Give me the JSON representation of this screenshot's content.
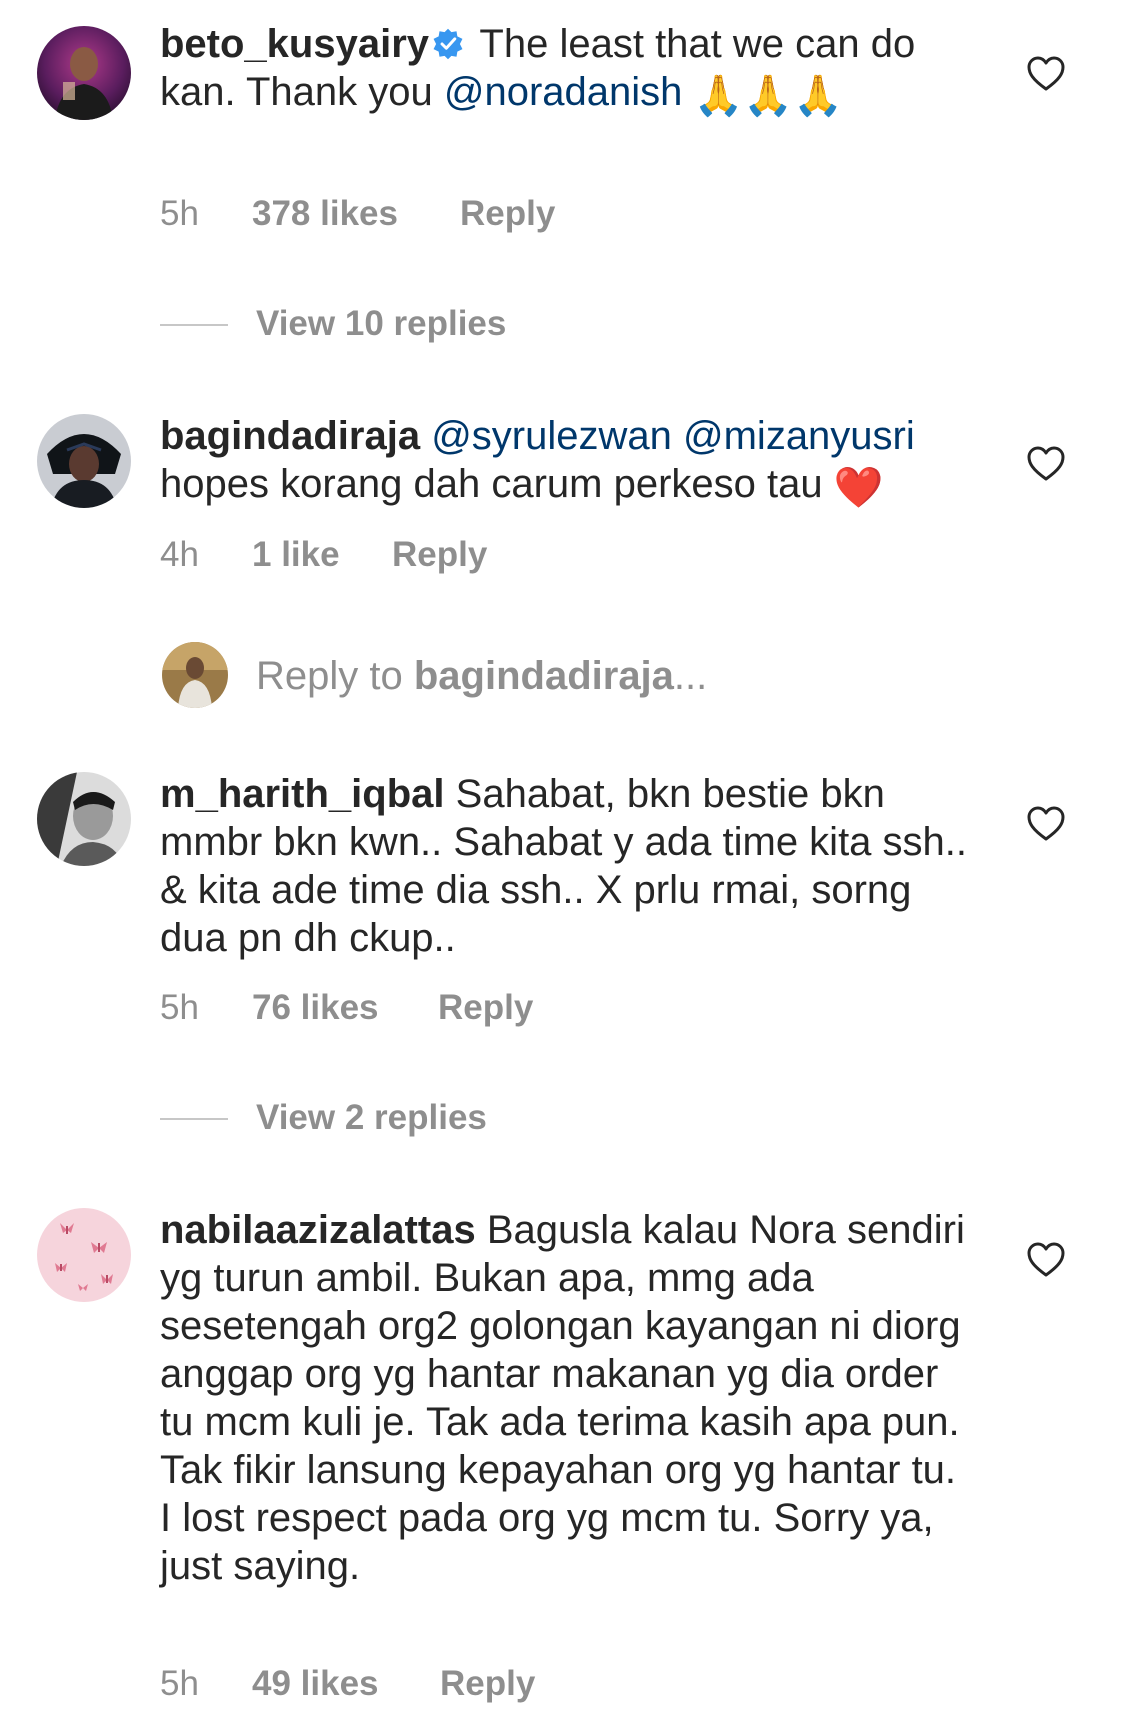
{
  "comments": [
    {
      "username": "beto_kusyairy",
      "verified": true,
      "text_before": "The least that we can do kan. Thank you ",
      "mention": "@noradanish",
      "emoji": "🙏🙏🙏",
      "time": "5h",
      "likes": "378 likes",
      "reply_label": "Reply",
      "view_replies": "View 10 replies"
    },
    {
      "username": "bagindadiraja",
      "mention1": "@syrulezwan",
      "mention2": "@mizanyusri",
      "text": "hopes korang dah carum perkeso tau",
      "emoji": "❤️",
      "time": "4h",
      "likes": "1 like",
      "reply_label": "Reply",
      "reply_prompt_prefix": "Reply to ",
      "reply_prompt_user": "bagindadiraja",
      "reply_prompt_suffix": "..."
    },
    {
      "username": "m_harith_iqbal",
      "text": "Sahabat, bkn bestie bkn mmbr bkn kwn.. Sahabat y ada time kita ssh.. & kita ade time dia ssh.. X prlu rmai, sorng dua pn dh ckup..",
      "time": "5h",
      "likes": "76 likes",
      "reply_label": "Reply",
      "view_replies": "View 2 replies"
    },
    {
      "username": "nabilaazizalattas",
      "text": "Bagusla kalau Nora sendiri yg turun ambil. Bukan apa, mmg ada sesetengah org2 golongan kayangan ni diorg anggap org yg hantar makanan yg dia order tu mcm kuli je. Tak ada terima kasih apa pun. Tak fikir lansung kepayahan org yg hantar tu. I lost respect pada org yg mcm tu. Sorry ya, just saying.",
      "time": "5h",
      "likes": "49 likes",
      "reply_label": "Reply"
    }
  ],
  "colors": {
    "text": "#262626",
    "secondary": "#8e8e8e",
    "mention": "#00376b",
    "verified": "#3897f0",
    "divider": "#c7c7c7"
  },
  "icons": {
    "like": "heart-outline-icon",
    "verified": "verified-badge-icon"
  }
}
